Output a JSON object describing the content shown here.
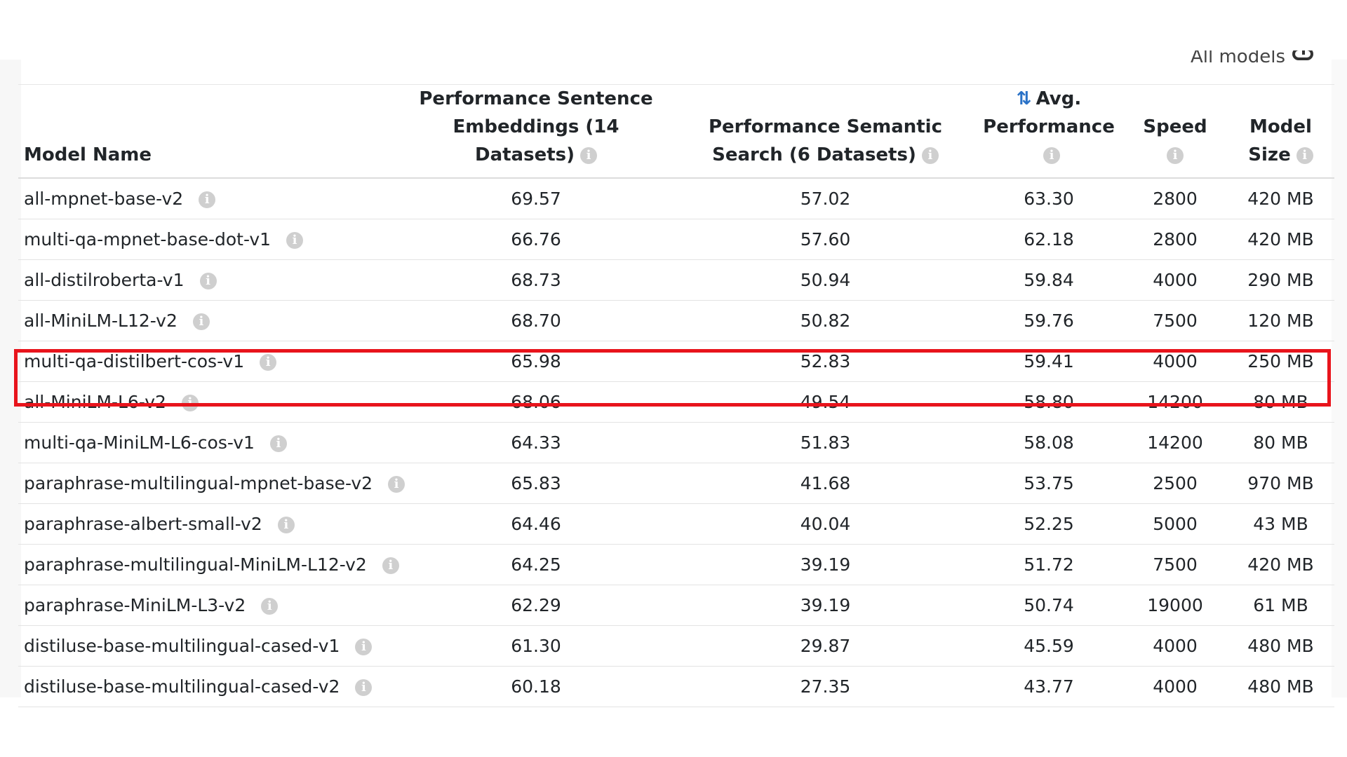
{
  "toolbar": {
    "all_models_label": "All models"
  },
  "table": {
    "headers": {
      "model_name": "Model Name",
      "perf_sentence_line1": "Performance Sentence",
      "perf_sentence_line2": "Embeddings (14 Datasets)",
      "perf_semantic_line1": "Performance Semantic",
      "perf_semantic_line2": "Search (6 Datasets)",
      "avg_perf_line1": "Avg.",
      "avg_perf_line2": "Performance",
      "speed": "Speed",
      "model_size_line1": "Model",
      "model_size_line2": "Size"
    },
    "rows": [
      {
        "name": "all-mpnet-base-v2",
        "sentence": "69.57",
        "semantic": "57.02",
        "avg": "63.30",
        "speed": "2800",
        "size": "420 MB"
      },
      {
        "name": "multi-qa-mpnet-base-dot-v1",
        "sentence": "66.76",
        "semantic": "57.60",
        "avg": "62.18",
        "speed": "2800",
        "size": "420 MB"
      },
      {
        "name": "all-distilroberta-v1",
        "sentence": "68.73",
        "semantic": "50.94",
        "avg": "59.84",
        "speed": "4000",
        "size": "290 MB"
      },
      {
        "name": "all-MiniLM-L12-v2",
        "sentence": "68.70",
        "semantic": "50.82",
        "avg": "59.76",
        "speed": "7500",
        "size": "120 MB"
      },
      {
        "name": "multi-qa-distilbert-cos-v1",
        "sentence": "65.98",
        "semantic": "52.83",
        "avg": "59.41",
        "speed": "4000",
        "size": "250 MB"
      },
      {
        "name": "all-MiniLM-L6-v2",
        "sentence": "68.06",
        "semantic": "49.54",
        "avg": "58.80",
        "speed": "14200",
        "size": "80 MB"
      },
      {
        "name": "multi-qa-MiniLM-L6-cos-v1",
        "sentence": "64.33",
        "semantic": "51.83",
        "avg": "58.08",
        "speed": "14200",
        "size": "80 MB"
      },
      {
        "name": "paraphrase-multilingual-mpnet-base-v2",
        "sentence": "65.83",
        "semantic": "41.68",
        "avg": "53.75",
        "speed": "2500",
        "size": "970 MB"
      },
      {
        "name": "paraphrase-albert-small-v2",
        "sentence": "64.46",
        "semantic": "40.04",
        "avg": "52.25",
        "speed": "5000",
        "size": "43 MB"
      },
      {
        "name": "paraphrase-multilingual-MiniLM-L12-v2",
        "sentence": "64.25",
        "semantic": "39.19",
        "avg": "51.72",
        "speed": "7500",
        "size": "420 MB"
      },
      {
        "name": "paraphrase-MiniLM-L3-v2",
        "sentence": "62.29",
        "semantic": "39.19",
        "avg": "50.74",
        "speed": "19000",
        "size": "61 MB"
      },
      {
        "name": "distiluse-base-multilingual-cased-v1",
        "sentence": "61.30",
        "semantic": "29.87",
        "avg": "45.59",
        "speed": "4000",
        "size": "480 MB"
      },
      {
        "name": "distiluse-base-multilingual-cased-v2",
        "sentence": "60.18",
        "semantic": "27.35",
        "avg": "43.77",
        "speed": "4000",
        "size": "480 MB"
      }
    ]
  },
  "colors": {
    "highlight": "#e8141c",
    "sort_icon": "#2a72c7",
    "info_icon": "#cfcfcf"
  },
  "icons": {
    "info": "info-icon",
    "sort": "sort-icon",
    "toggle": "toggle-icon"
  }
}
